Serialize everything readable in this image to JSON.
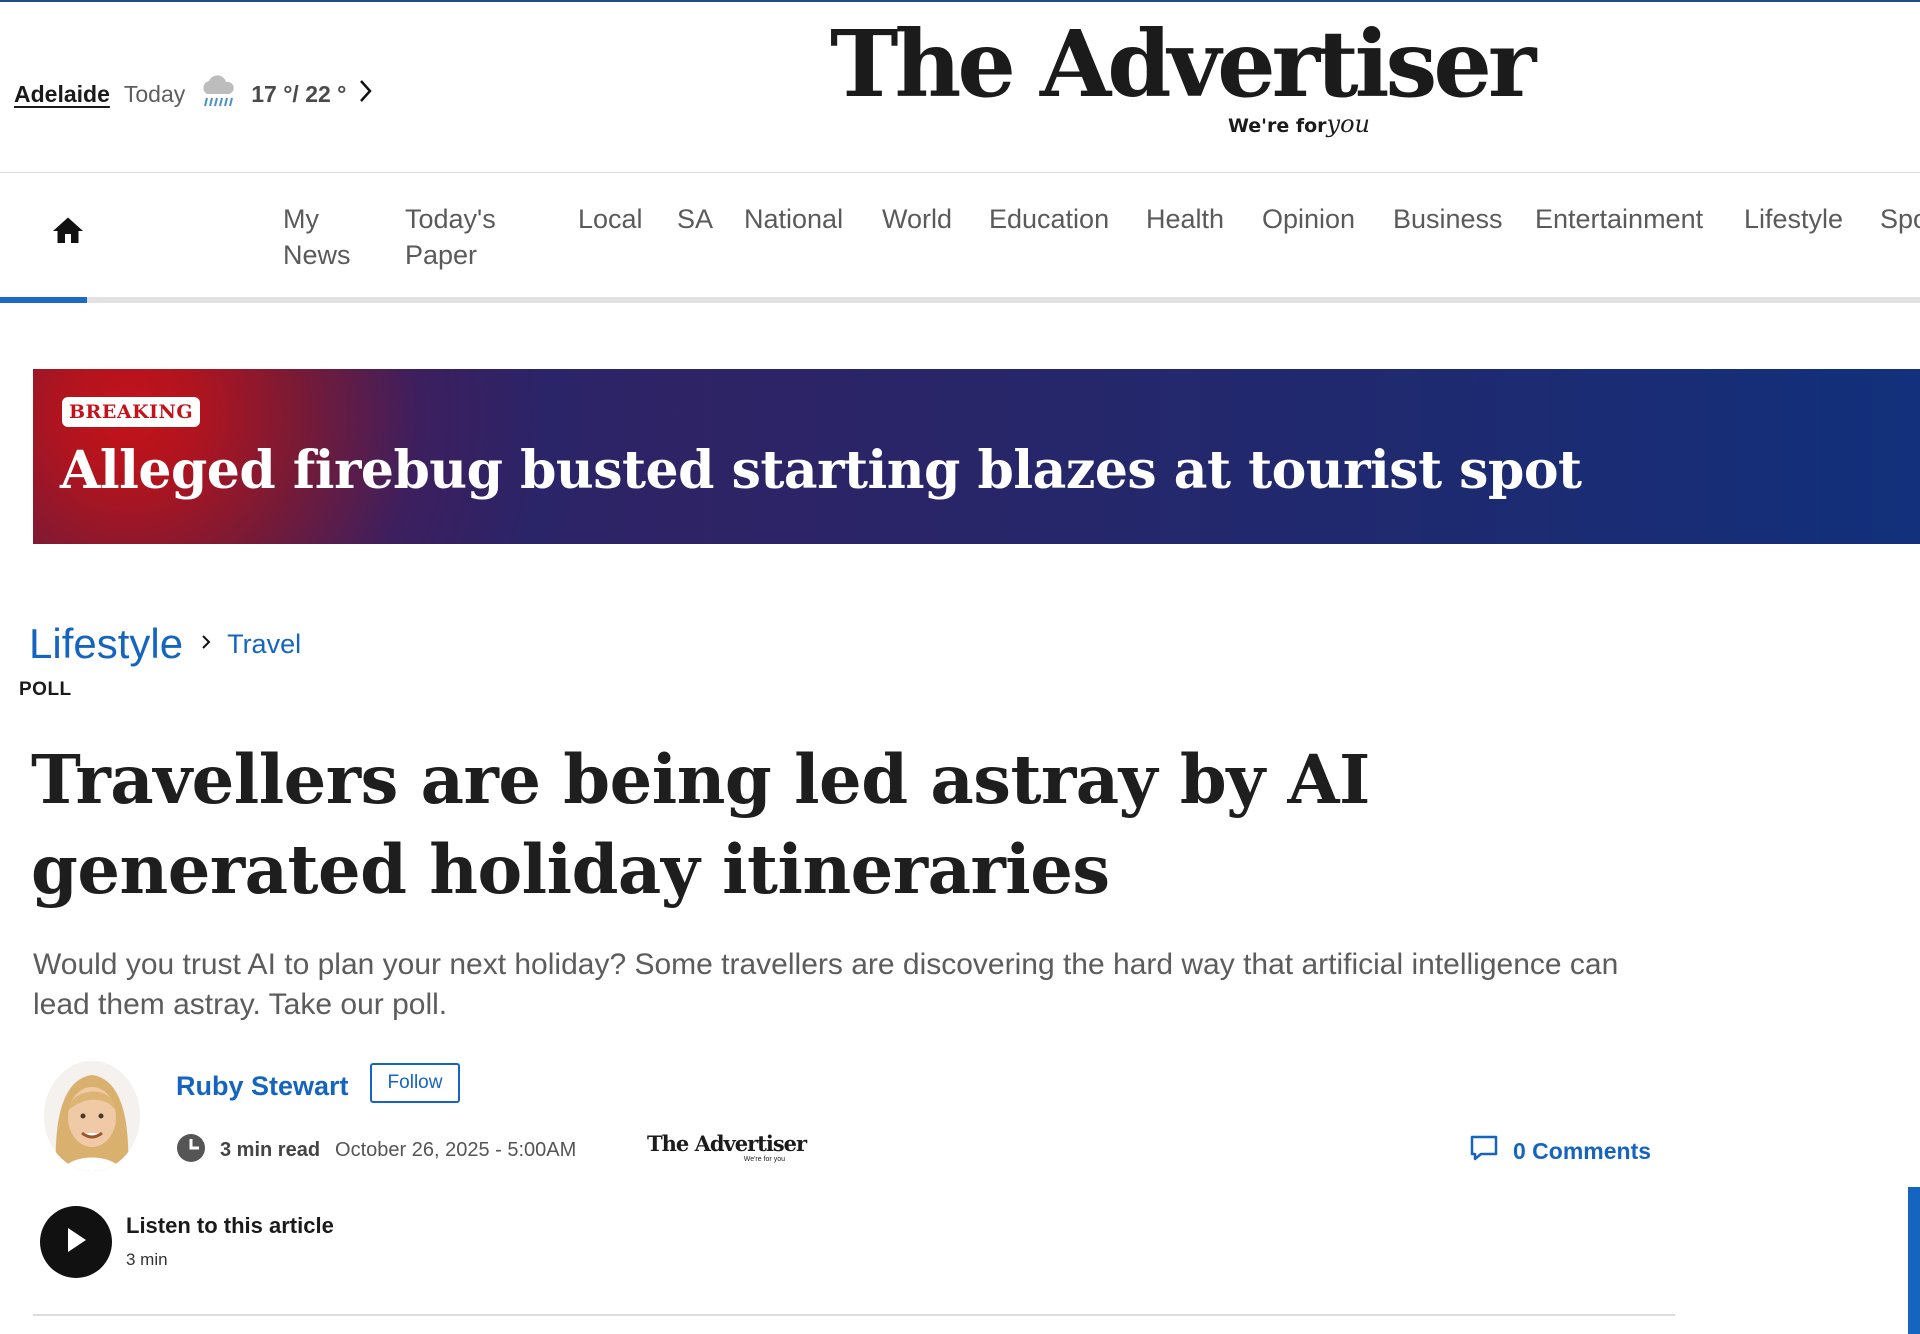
{
  "colors": {
    "accent": "#1565c0",
    "breaking_red": "#c4121a",
    "banner_navy": "#1e2a70"
  },
  "weather": {
    "location": "Adelaide",
    "day": "Today",
    "icon": "rain-cloud-icon",
    "temps": "17 °/ 22 °"
  },
  "masthead": {
    "name": "The Advertiser",
    "tagline_lead": "We're for",
    "tagline_script": "you"
  },
  "nav": {
    "items": [
      {
        "label": "My\nNews"
      },
      {
        "label": "Today's\nPaper"
      },
      {
        "label": "Local"
      },
      {
        "label": "SA"
      },
      {
        "label": "National"
      },
      {
        "label": "World"
      },
      {
        "label": "Education"
      },
      {
        "label": "Health"
      },
      {
        "label": "Opinion"
      },
      {
        "label": "Business"
      },
      {
        "label": "Entertainment"
      },
      {
        "label": "Lifestyle"
      },
      {
        "label": "Spo"
      }
    ]
  },
  "breaking": {
    "badge": "BREAKING",
    "headline": "Alleged firebug busted starting blazes at tourist spot"
  },
  "article": {
    "section": "Lifestyle",
    "subsection": "Travel",
    "kicker": "POLL",
    "title": "Travellers are being led astray by AI generated holiday itineraries",
    "standfirst": "Would you trust AI to plan your next holiday? Some travellers are discovering the hard way that artificial intelligence can lead them astray. Take our poll.",
    "author": "Ruby Stewart",
    "follow_label": "Follow",
    "read_time": "3 min read",
    "date": "October 26, 2025 - 5:00AM",
    "publisher": "The Advertiser",
    "publisher_tagline": "We're for you",
    "comments_label": "0 Comments"
  },
  "audio": {
    "label": "Listen to this article",
    "duration": "3 min"
  }
}
